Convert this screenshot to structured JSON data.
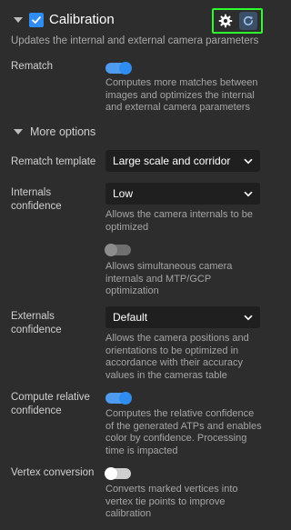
{
  "header": {
    "title": "Calibration",
    "subtitle": "Updates the internal and external camera parameters"
  },
  "rematch": {
    "label": "Rematch",
    "state": "on",
    "description": "Computes more matches between images and optimizes the internal and external camera parameters"
  },
  "more_options": {
    "label": "More options"
  },
  "rematch_template": {
    "label": "Rematch template",
    "value": "Large scale and corridor"
  },
  "internals": {
    "label": "Internals confidence",
    "value": "Low",
    "description": "Allows the camera internals to be optimized",
    "toggle_state": "off",
    "toggle_description": "Allows simultaneous camera internals and MTP/GCP optimization"
  },
  "externals": {
    "label": "Externals confidence",
    "value": "Default",
    "description": "Allows the camera positions and orientations to be optimized in accordance with their accuracy values in the cameras table"
  },
  "relative_confidence": {
    "label": "Compute relative confidence",
    "state": "on",
    "description": "Computes the relative confidence of the generated ATPs and enables color by confidence. Processing time is impacted"
  },
  "vertex_conversion": {
    "label": "Vertex conversion",
    "state": "off",
    "description": "Converts marked vertices into vertex tie points to improve calibration"
  },
  "colors": {
    "accent": "#2f8cf0",
    "highlight": "#2cff2c",
    "background": "#2d2d2d"
  },
  "icons": [
    "caret-down-icon",
    "check-icon",
    "gear-icon",
    "refresh-icon",
    "chevron-down-icon"
  ]
}
